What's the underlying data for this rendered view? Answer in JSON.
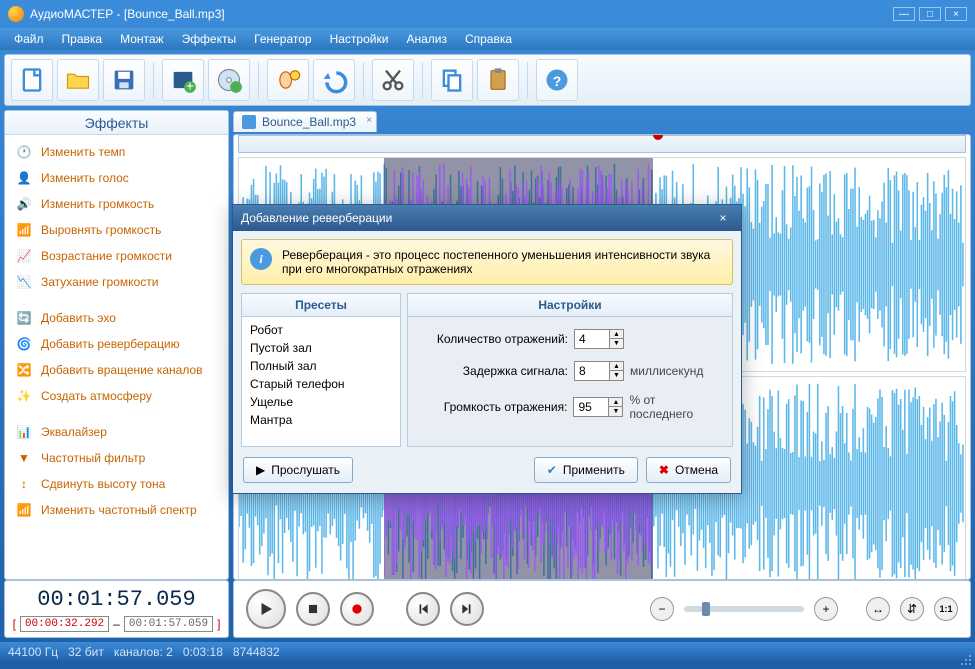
{
  "window": {
    "title": "АудиоМАСТЕР - [Bounce_Ball.mp3]"
  },
  "menu": [
    "Файл",
    "Правка",
    "Монтаж",
    "Эффекты",
    "Генератор",
    "Настройки",
    "Анализ",
    "Справка"
  ],
  "sidebar": {
    "header": "Эффекты",
    "groups": [
      [
        "Изменить темп",
        "Изменить голос",
        "Изменить громкость",
        "Выровнять громкость",
        "Возрастание громкости",
        "Затухание громкости"
      ],
      [
        "Добавить эхо",
        "Добавить реверберацию",
        "Добавить вращение каналов",
        "Создать атмосферу"
      ],
      [
        "Эквалайзер",
        "Частотный фильтр",
        "Сдвинуть высоту тона",
        "Изменить частотный спектр"
      ]
    ]
  },
  "tab": {
    "label": "Bounce_Ball.mp3"
  },
  "time": {
    "current": "00:01:57.059",
    "sel_start": "00:00:32.292",
    "sel_end": "00:01:57.059",
    "sep": "–"
  },
  "status": {
    "rate": "44100 Гц",
    "bits": "32 бит",
    "channels": "каналов: 2",
    "dur": "0:03:18",
    "extra": "8744832"
  },
  "dialog": {
    "title": "Добавление реверберации",
    "info": "Реверберация - это процесс постепенного уменьшения интенсивности звука при его многократных отражениях",
    "presets_hdr": "Пресеты",
    "settings_hdr": "Настройки",
    "presets": [
      "Робот",
      "Пустой зал",
      "Полный зал",
      "Старый телефон",
      "Ущелье",
      "Мантра"
    ],
    "rows": {
      "count": {
        "label": "Количество отражений:",
        "value": "4",
        "unit": ""
      },
      "delay": {
        "label": "Задержка сигнала:",
        "value": "8",
        "unit": "миллисекунд"
      },
      "vol": {
        "label": "Громкость отражения:",
        "value": "95",
        "unit": "% от последнего"
      }
    },
    "btn_listen": "Прослушать",
    "btn_apply": "Применить",
    "btn_cancel": "Отмена"
  },
  "accent": "#4a9ae0",
  "wave_color": "#5db8ea",
  "sel_wave_color": "#9a5cf0"
}
